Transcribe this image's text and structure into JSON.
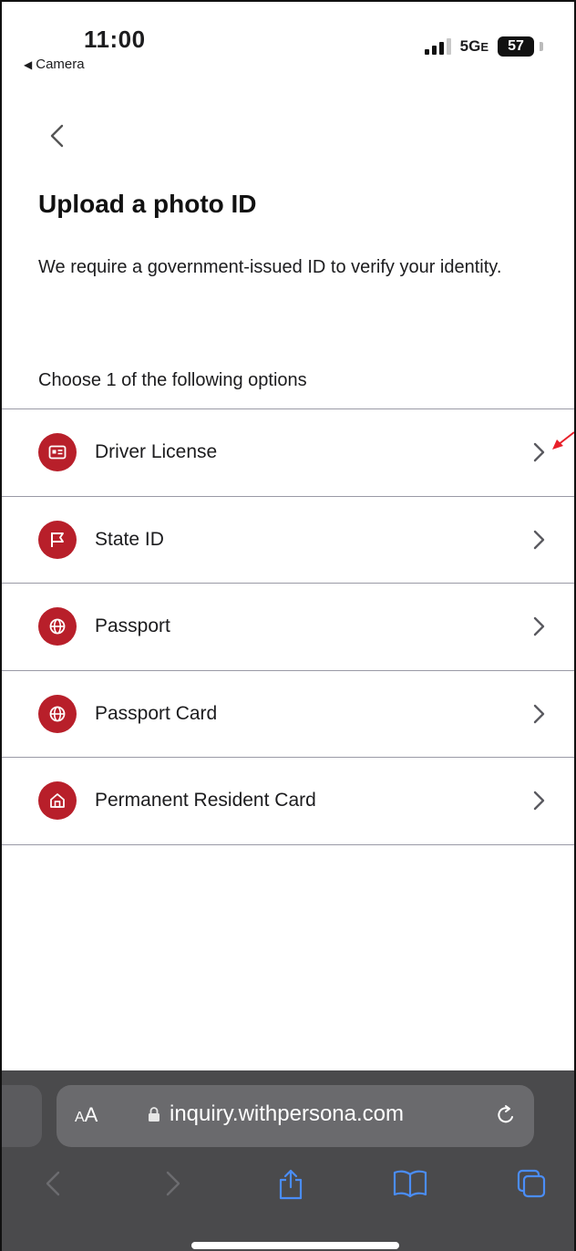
{
  "status_bar": {
    "time": "11:00",
    "back_app": "Camera",
    "network": "5G",
    "network_suffix": "E",
    "battery": "57"
  },
  "page": {
    "back_icon": "chevron-left-icon",
    "title": "Upload a photo ID",
    "description": "We require a government-issued ID to verify your identity.",
    "choose_prompt": "Choose 1 of the following options"
  },
  "options": [
    {
      "label": "Driver License",
      "icon": "id-card-icon"
    },
    {
      "label": "State ID",
      "icon": "flag-icon"
    },
    {
      "label": "Passport",
      "icon": "globe-icon"
    },
    {
      "label": "Passport Card",
      "icon": "globe-icon"
    },
    {
      "label": "Permanent Resident Card",
      "icon": "home-icon"
    }
  ],
  "browser": {
    "text_size_big": "A",
    "text_size_small": "A",
    "url": "inquiry.withpersona.com"
  },
  "colors": {
    "accent": "#b81f2a",
    "browser_bar": "#4a4a4c",
    "share_blue": "#4a8df7"
  }
}
